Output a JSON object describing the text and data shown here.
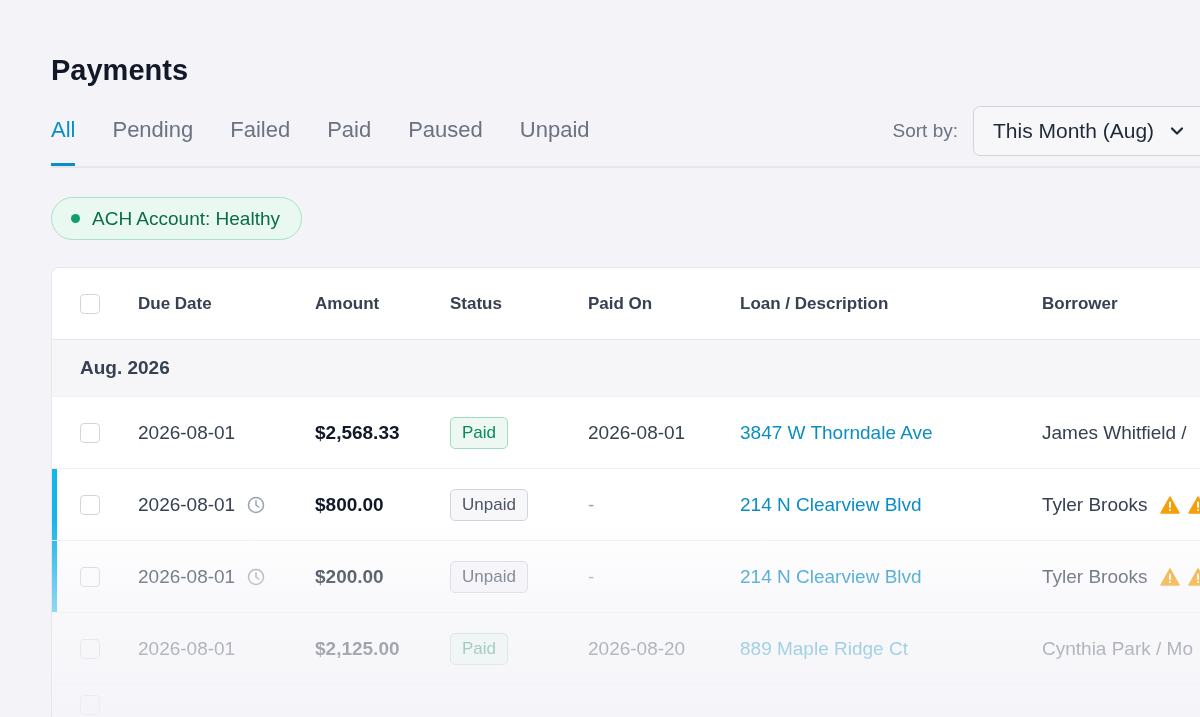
{
  "page": {
    "title": "Payments"
  },
  "tabs": [
    {
      "label": "All",
      "selected": true
    },
    {
      "label": "Pending",
      "selected": false
    },
    {
      "label": "Failed",
      "selected": false
    },
    {
      "label": "Paid",
      "selected": false
    },
    {
      "label": "Paused",
      "selected": false
    },
    {
      "label": "Unpaid",
      "selected": false
    }
  ],
  "sort": {
    "label": "Sort by:",
    "value": "This Month (Aug)"
  },
  "account_status": {
    "label": "ACH Account: Healthy",
    "color": "#0e9f6e"
  },
  "table": {
    "columns": [
      "Due Date",
      "Amount",
      "Status",
      "Paid On",
      "Loan / Description",
      "Borrower"
    ],
    "header_checked": false,
    "next_row_checked": false,
    "group": "Aug. 2026",
    "rows": [
      {
        "checked": false,
        "flagged": false,
        "scheduled": false,
        "due_date": "2026-08-01",
        "amount": "$2,568.33",
        "status": {
          "kind": "paid",
          "label": "Paid"
        },
        "paid_on": "2026-08-01",
        "loan": "3847 W Thorndale Ave",
        "borrower": "James Whitfield /",
        "warning": false
      },
      {
        "checked": false,
        "flagged": true,
        "scheduled": true,
        "due_date": "2026-08-01",
        "amount": "$800.00",
        "status": {
          "kind": "unpaid",
          "label": "Unpaid"
        },
        "paid_on": "-",
        "loan": "214 N Clearview Blvd",
        "borrower": "Tyler Brooks",
        "warning": true
      },
      {
        "checked": false,
        "flagged": true,
        "scheduled": true,
        "due_date": "2026-08-01",
        "amount": "$200.00",
        "status": {
          "kind": "unpaid",
          "label": "Unpaid"
        },
        "paid_on": "-",
        "loan": "214 N Clearview Blvd",
        "borrower": "Tyler Brooks",
        "warning": true
      },
      {
        "checked": false,
        "flagged": false,
        "scheduled": false,
        "due_date": "2026-08-01",
        "amount": "$2,125.00",
        "status": {
          "kind": "paid",
          "label": "Paid"
        },
        "paid_on": "2026-08-20",
        "loan": "889 Maple Ridge Ct",
        "borrower": "Cynthia Park / Mo",
        "warning": false
      }
    ]
  }
}
